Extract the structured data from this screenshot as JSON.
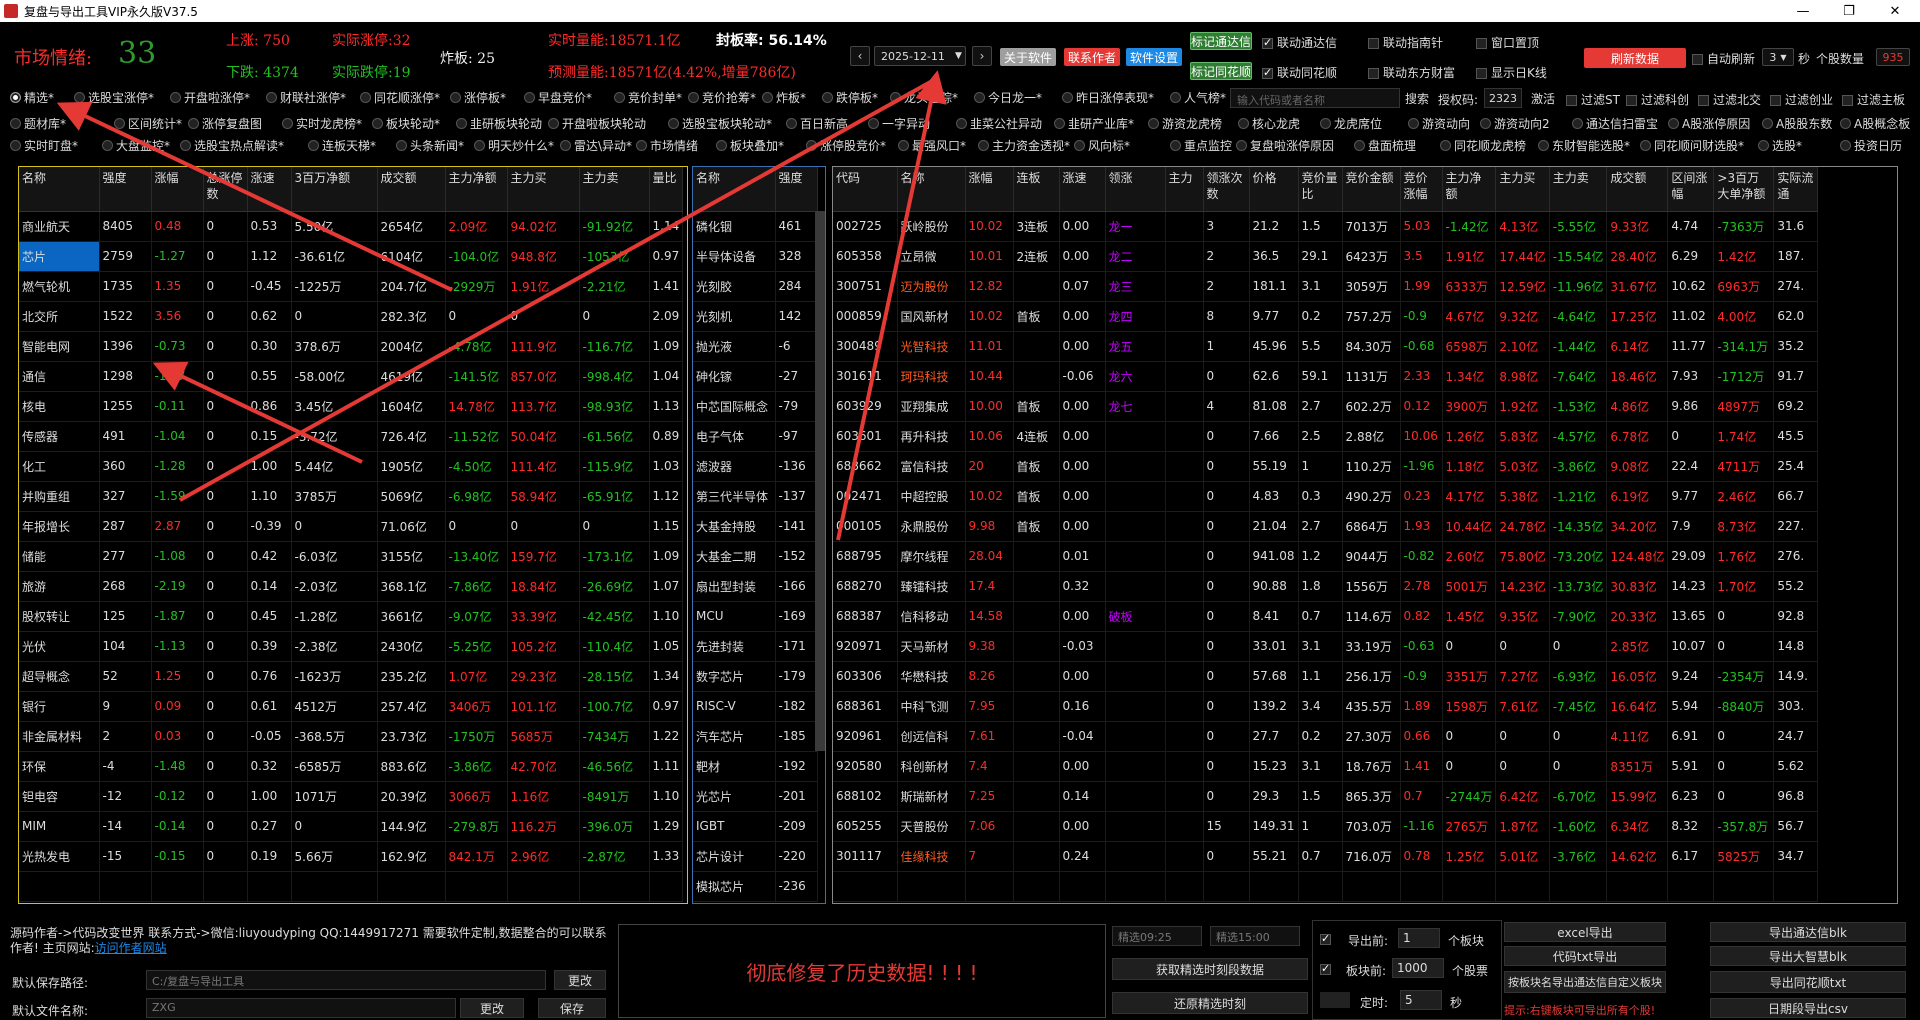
{
  "window": {
    "title": "复盘与导出工具VIP永久版V37.5"
  },
  "header": {
    "sentiment_label": "市场情绪:",
    "sentiment_value": "33",
    "up_label": "上涨:",
    "up_value": "750",
    "limit_up_label": "实际涨停:",
    "limit_up_value": "32",
    "down_label": "下跌:",
    "down_value": "4374",
    "limit_down_label": "实际跌停:",
    "limit_down_value": "19",
    "broken_label": "炸板:",
    "broken_value": "25",
    "realtime_label": "实时量能:",
    "realtime_value": "18571.1亿",
    "seal_rate": "封板率: 56.14%",
    "forecast_label": "预测量能:",
    "forecast_value": "18571亿(4.42%,增量786亿)",
    "date": "2025-12-11",
    "about": "关于软件",
    "contact": "联系作者",
    "settings": "软件设置",
    "mark_tdx": "标记通达信",
    "mark_ths": "标记同花顺",
    "link_tdx": "联动通达信",
    "link_ths": "联动同花顺",
    "link_znz": "联动指南针",
    "link_dfcf": "联动东方财富",
    "window_top": "窗口置顶",
    "show_day_k": "显示日K线",
    "refresh": "刷新数据",
    "auto_refresh": "自动刷新",
    "refresh_seconds": "3",
    "seconds_unit": "秒",
    "stock_count_label": "个股数量",
    "stock_count": "935",
    "colors": {
      "up": "#ff2a2a",
      "down": "#22c022",
      "accent": "#0a66c2"
    }
  },
  "options_row1": [
    "精选*",
    "选股宝涨停*",
    "开盘啦涨停*",
    "财联社涨停*",
    "同花顺涨停*",
    "涨停板*",
    "早盘竞价*",
    "竞价封单*",
    "竞价抢筹*",
    "炸板*",
    "跌停板*",
    "龙头追踪*",
    "今日龙一*",
    "昨日涨停表现*",
    "人气榜*"
  ],
  "search": {
    "placeholder": "输入代码或者名称",
    "button": "搜索",
    "auth_label": "授权码:",
    "auth_value": "2323",
    "activate": "激活",
    "f1": "过滤ST",
    "f2": "过滤科创",
    "f3": "过滤北交",
    "f4": "过滤创业",
    "f5": "过滤主板"
  },
  "options_row2": [
    "题材库*",
    "区间统计*",
    "涨停复盘图",
    "实时龙虎榜*",
    "板块轮动*",
    "韭研板块轮动",
    "开盘啦板块轮动",
    "选股宝板块轮动*",
    "百日新高",
    "一字异动",
    "韭菜公社异动",
    "韭研产业库*",
    "游资龙虎榜",
    "核心龙虎",
    "龙虎席位",
    "游资动向",
    "游资动向2",
    "通达信扫雷宝",
    "A股涨停原因",
    "A股股东数",
    "A股概念板"
  ],
  "options_row3": [
    "实时盯盘*",
    "大盘监控*",
    "选股宝热点解读*",
    "连板天梯*",
    "头条新闻*",
    "明天炒什么*",
    "雷达\\异动*",
    "市场情绪",
    "板块叠加*",
    "涨停股竞价*",
    "最强风口*",
    "主力资金透视*",
    "风向标*",
    "重点监控",
    "复盘啦涨停原因",
    "盘面梳理",
    "同花顺龙虎榜",
    "东财智能选股*",
    "同花顺问财选股*",
    "选股*",
    "投资日历"
  ],
  "sector_table": {
    "headers": [
      "名称",
      "强度",
      "涨幅",
      "总涨停数",
      "涨速",
      "3百万净额",
      "成交额",
      "主力净额",
      "主力买",
      "主力卖",
      "量比"
    ],
    "rows": [
      [
        "商业航天",
        "8405",
        "0.48",
        "0",
        "0.53",
        "5.50亿",
        "2654亿",
        "2.09亿",
        "94.02亿",
        "-91.92亿",
        "1.14"
      ],
      [
        "芯片",
        "2759",
        "-1.27",
        "0",
        "1.12",
        "-36.61亿",
        "6104亿",
        "-104.0亿",
        "948.8亿",
        "-1053亿",
        "0.97"
      ],
      [
        "燃气轮机",
        "1735",
        "1.35",
        "0",
        "-0.45",
        "-1225万",
        "204.7亿",
        "-2929万",
        "1.91亿",
        "-2.21亿",
        "1.41"
      ],
      [
        "北交所",
        "1522",
        "3.56",
        "0",
        "0.62",
        "0",
        "282.3亿",
        "0",
        "0",
        "0",
        "2.09"
      ],
      [
        "智能电网",
        "1396",
        "-0.73",
        "0",
        "0.30",
        "378.6万",
        "2004亿",
        "-4.78亿",
        "111.9亿",
        "-116.7亿",
        "1.09"
      ],
      [
        "通信",
        "1298",
        "-1.47",
        "0",
        "0.55",
        "-58.00亿",
        "4619亿",
        "-141.5亿",
        "857.0亿",
        "-998.4亿",
        "1.04"
      ],
      [
        "核电",
        "1255",
        "-0.11",
        "0",
        "0.86",
        "3.45亿",
        "1604亿",
        "14.78亿",
        "113.7亿",
        "-98.93亿",
        "1.13"
      ],
      [
        "传感器",
        "491",
        "-1.04",
        "0",
        "0.15",
        "-3.72亿",
        "726.4亿",
        "-11.52亿",
        "50.04亿",
        "-61.56亿",
        "0.89"
      ],
      [
        "化工",
        "360",
        "-1.28",
        "0",
        "1.00",
        "5.44亿",
        "1905亿",
        "-4.50亿",
        "111.4亿",
        "-115.9亿",
        "1.03"
      ],
      [
        "并购重组",
        "327",
        "-1.59",
        "0",
        "1.10",
        "3785万",
        "5069亿",
        "-6.98亿",
        "58.94亿",
        "-65.91亿",
        "1.12"
      ],
      [
        "年报增长",
        "287",
        "2.87",
        "0",
        "-0.39",
        "0",
        "71.06亿",
        "0",
        "0",
        "0",
        "1.15"
      ],
      [
        "储能",
        "277",
        "-1.08",
        "0",
        "0.42",
        "-6.03亿",
        "3155亿",
        "-13.40亿",
        "159.7亿",
        "-173.1亿",
        "1.09"
      ],
      [
        "旅游",
        "268",
        "-2.19",
        "0",
        "0.14",
        "-2.03亿",
        "368.1亿",
        "-7.86亿",
        "18.84亿",
        "-26.69亿",
        "1.07"
      ],
      [
        "股权转让",
        "125",
        "-1.87",
        "0",
        "0.45",
        "-1.28亿",
        "3661亿",
        "-9.07亿",
        "33.39亿",
        "-42.45亿",
        "1.10"
      ],
      [
        "光伏",
        "104",
        "-1.13",
        "0",
        "0.39",
        "-2.38亿",
        "2430亿",
        "-5.25亿",
        "105.2亿",
        "-110.4亿",
        "1.05"
      ],
      [
        "超导概念",
        "52",
        "1.25",
        "0",
        "0.76",
        "-1623万",
        "235.2亿",
        "1.07亿",
        "29.23亿",
        "-28.15亿",
        "1.34"
      ],
      [
        "银行",
        "9",
        "0.09",
        "0",
        "0.61",
        "4512万",
        "257.4亿",
        "3406万",
        "101.1亿",
        "-100.7亿",
        "0.97"
      ],
      [
        "非金属材料",
        "2",
        "0.03",
        "0",
        "-0.05",
        "-368.5万",
        "23.73亿",
        "-1750万",
        "5685万",
        "-7434万",
        "1.22"
      ],
      [
        "环保",
        "-4",
        "-1.48",
        "0",
        "0.32",
        "-6585万",
        "883.6亿",
        "-3.86亿",
        "42.70亿",
        "-46.56亿",
        "1.11"
      ],
      [
        "钽电容",
        "-12",
        "-0.12",
        "0",
        "1.00",
        "1071万",
        "20.39亿",
        "3066万",
        "1.16亿",
        "-8491万",
        "1.10"
      ],
      [
        "MIM",
        "-14",
        "-0.14",
        "0",
        "0.27",
        "0",
        "144.9亿",
        "-279.8万",
        "116.2万",
        "-396.0万",
        "1.29"
      ],
      [
        "光热发电",
        "-15",
        "-0.15",
        "0",
        "0.19",
        "5.66万",
        "162.9亿",
        "842.1万",
        "2.96亿",
        "-2.87亿",
        "1.33"
      ],
      [
        "",
        "",
        "",
        "",
        "",
        "",
        "",
        "",
        "",
        "",
        ""
      ]
    ]
  },
  "concept_table": {
    "headers": [
      "名称",
      "强度"
    ],
    "rows": [
      [
        "磷化铟",
        "461"
      ],
      [
        "半导体设备",
        "328"
      ],
      [
        "光刻胶",
        "284"
      ],
      [
        "光刻机",
        "142"
      ],
      [
        "抛光液",
        "-6"
      ],
      [
        "砷化镓",
        "-27"
      ],
      [
        "中芯国际概念",
        "-79"
      ],
      [
        "电子气体",
        "-97"
      ],
      [
        "滤波器",
        "-136"
      ],
      [
        "第三代半导体",
        "-137"
      ],
      [
        "大基金持股",
        "-141"
      ],
      [
        "大基金二期",
        "-152"
      ],
      [
        "扇出型封装",
        "-166"
      ],
      [
        "MCU",
        "-169"
      ],
      [
        "先进封装",
        "-171"
      ],
      [
        "数字芯片",
        "-179"
      ],
      [
        "RISC-V",
        "-182"
      ],
      [
        "汽车芯片",
        "-185"
      ],
      [
        "靶材",
        "-192"
      ],
      [
        "光芯片",
        "-201"
      ],
      [
        "IGBT",
        "-209"
      ],
      [
        "芯片设计",
        "-220"
      ],
      [
        "模拟芯片",
        "-236"
      ]
    ]
  },
  "stock_table": {
    "headers": [
      "代码",
      "名称",
      "涨幅",
      "连板",
      "涨速",
      "领涨",
      "主力",
      "领涨次数",
      "价格",
      "竞价量比",
      "竞价金额",
      "竞价涨幅",
      "主力净额",
      "主力买",
      "主力卖",
      "成交额",
      "区间涨幅",
      ">3百万大单净额",
      "实际流通"
    ],
    "rows": [
      [
        "002725",
        "跃岭股份",
        "10.02",
        "3连板",
        "0.00",
        "龙一",
        "",
        "3",
        "21.2",
        "1.5",
        "7013万",
        "5.03",
        "-1.42亿",
        "4.13亿",
        "-5.55亿",
        "9.33亿",
        "4.74",
        "-7363万",
        "31.6"
      ],
      [
        "605358",
        "立昂微",
        "10.01",
        "2连板",
        "0.00",
        "龙二",
        "",
        "2",
        "36.5",
        "29.1",
        "6423万",
        "3.5",
        "1.91亿",
        "17.44亿",
        "-15.54亿",
        "28.40亿",
        "6.29",
        "1.42亿",
        "187."
      ],
      [
        "300751",
        "迈为股份",
        "12.82",
        "",
        "0.07",
        "龙三",
        "",
        "2",
        "181.1",
        "3.1",
        "3059万",
        "1.99",
        "6333万",
        "12.59亿",
        "-11.96亿",
        "31.67亿",
        "10.62",
        "6963万",
        "274."
      ],
      [
        "000859",
        "国风新材",
        "10.02",
        "首板",
        "0.00",
        "龙四",
        "",
        "8",
        "9.77",
        "0.2",
        "757.2万",
        "-0.9",
        "4.67亿",
        "9.32亿",
        "-4.64亿",
        "17.25亿",
        "11.02",
        "4.00亿",
        "62.0"
      ],
      [
        "300489",
        "光智科技",
        "11.01",
        "",
        "0.00",
        "龙五",
        "",
        "1",
        "45.96",
        "5.5",
        "84.30万",
        "-0.68",
        "6598万",
        "2.10亿",
        "-1.44亿",
        "6.14亿",
        "11.77",
        "-314.1万",
        "35.2"
      ],
      [
        "301611",
        "珂玛科技",
        "10.44",
        "",
        "-0.06",
        "龙六",
        "",
        "0",
        "62.6",
        "59.1",
        "1131万",
        "2.33",
        "1.34亿",
        "8.98亿",
        "-7.64亿",
        "18.46亿",
        "7.93",
        "-1712万",
        "91.7"
      ],
      [
        "603929",
        "亚翔集成",
        "10.00",
        "首板",
        "0.00",
        "龙七",
        "",
        "4",
        "81.08",
        "2.7",
        "602.2万",
        "0.12",
        "3900万",
        "1.92亿",
        "-1.53亿",
        "4.86亿",
        "9.86",
        "4897万",
        "69.2"
      ],
      [
        "603601",
        "再升科技",
        "10.06",
        "4连板",
        "0.00",
        "",
        "",
        "0",
        "7.66",
        "2.5",
        "2.88亿",
        "10.06",
        "1.26亿",
        "5.83亿",
        "-4.57亿",
        "6.78亿",
        "0",
        "1.74亿",
        "45.5"
      ],
      [
        "688662",
        "富信科技",
        "20",
        "首板",
        "0.00",
        "",
        "",
        "0",
        "55.19",
        "1",
        "110.2万",
        "-1.96",
        "1.18亿",
        "5.03亿",
        "-3.86亿",
        "9.08亿",
        "22.4",
        "4711万",
        "25.4"
      ],
      [
        "002471",
        "中超控股",
        "10.02",
        "首板",
        "0.00",
        "",
        "",
        "0",
        "4.83",
        "0.3",
        "490.2万",
        "0.23",
        "4.17亿",
        "5.38亿",
        "-1.21亿",
        "6.19亿",
        "9.77",
        "2.46亿",
        "66.7"
      ],
      [
        "000105",
        "永鼎股份",
        "9.98",
        "首板",
        "0.00",
        "",
        "",
        "0",
        "21.04",
        "2.7",
        "6864万",
        "1.93",
        "10.44亿",
        "24.78亿",
        "-14.35亿",
        "34.20亿",
        "7.9",
        "8.73亿",
        "227."
      ],
      [
        "688795",
        "摩尔线程",
        "28.04",
        "",
        "0.01",
        "",
        "",
        "0",
        "941.08",
        "1.2",
        "9044万",
        "-0.82",
        "2.60亿",
        "75.80亿",
        "-73.20亿",
        "124.48亿",
        "29.09",
        "1.76亿",
        "276."
      ],
      [
        "688270",
        "臻镭科技",
        "17.4",
        "",
        "0.32",
        "",
        "",
        "0",
        "90.88",
        "1.8",
        "1556万",
        "2.78",
        "5001万",
        "14.23亿",
        "-13.73亿",
        "30.83亿",
        "14.23",
        "1.70亿",
        "55.2"
      ],
      [
        "688387",
        "信科移动",
        "14.58",
        "",
        "0.00",
        "破板",
        "",
        "0",
        "8.41",
        "0.7",
        "114.6万",
        "0.82",
        "1.45亿",
        "9.35亿",
        "-7.90亿",
        "20.33亿",
        "13.65",
        "0",
        "92.8"
      ],
      [
        "920971",
        "天马新材",
        "9.38",
        "",
        "-0.03",
        "",
        "",
        "0",
        "33.01",
        "3.1",
        "33.19万",
        "-0.63",
        "0",
        "0",
        "0",
        "2.85亿",
        "10.07",
        "0",
        "14.8"
      ],
      [
        "603306",
        "华懋科技",
        "8.26",
        "",
        "0.00",
        "",
        "",
        "0",
        "57.68",
        "1.1",
        "256.1万",
        "-0.9",
        "3351万",
        "7.27亿",
        "-6.93亿",
        "16.05亿",
        "9.24",
        "-2354万",
        "14.9."
      ],
      [
        "688361",
        "中科飞测",
        "7.95",
        "",
        "0.16",
        "",
        "",
        "0",
        "139.2",
        "3.4",
        "435.5万",
        "1.89",
        "1598万",
        "7.61亿",
        "-7.45亿",
        "16.64亿",
        "5.94",
        "-8840万",
        "303."
      ],
      [
        "920961",
        "创远信科",
        "7.61",
        "",
        "-0.04",
        "",
        "",
        "0",
        "27.7",
        "0.2",
        "27.30万",
        "0.66",
        "0",
        "0",
        "0",
        "4.11亿",
        "6.91",
        "0",
        "24.7"
      ],
      [
        "920580",
        "科创新材",
        "7.4",
        "",
        "0.00",
        "",
        "",
        "0",
        "15.23",
        "3.1",
        "18.76万",
        "1.41",
        "0",
        "0",
        "0",
        "8351万",
        "5.91",
        "0",
        "5.62"
      ],
      [
        "688102",
        "斯瑞新材",
        "7.25",
        "",
        "0.14",
        "",
        "",
        "0",
        "29.3",
        "1.5",
        "865.3万",
        "0.7",
        "-2744万",
        "6.42亿",
        "-6.70亿",
        "15.99亿",
        "6.23",
        "0",
        "96.8"
      ],
      [
        "605255",
        "天普股份",
        "7.06",
        "",
        "0.00",
        "",
        "",
        "15",
        "149.31",
        "1",
        "703.0万",
        "-1.16",
        "2765万",
        "1.87亿",
        "-1.60亿",
        "6.34亿",
        "8.32",
        "-357.8万",
        "56.7"
      ],
      [
        "301117",
        "佳缘科技",
        "7",
        "",
        "0.24",
        "",
        "",
        "0",
        "55.21",
        "0.7",
        "716.0万",
        "0.78",
        "1.25亿",
        "5.01亿",
        "-3.76亿",
        "14.62亿",
        "6.17",
        "5825万",
        "34.7"
      ],
      [
        "",
        "",
        "",
        "",
        "",
        "",
        "",
        "",
        "",
        "",
        "",
        "",
        "",
        "",
        "",
        "",
        "",
        "",
        ""
      ]
    ]
  },
  "bottom": {
    "author_text": "源码作者->代码改变世界 联系方式->微信:liuyoudyping QQ:1449917271 需要软件定制,数据整合的可以联系作者! 主页网站:",
    "author_link": "访问作者网站",
    "save_path_label": "默认保存路径:",
    "save_path": "C:/复盘与导出工具",
    "change1": "更改",
    "file_name_label": "默认文件名称:",
    "file_name": "ZXG",
    "change2": "更改",
    "save": "保存",
    "notice": "彻底修复了历史数据! ! ! !",
    "pick0925": "精选09:25",
    "pick1500": "精选15:00",
    "get_pick": "获取精选时刻段数据",
    "restore_pick": "还原精选时刻",
    "export_front_label": "导出前:",
    "export_front_val": "1",
    "sector_unit": "个板块",
    "sector_front_label": "板块前:",
    "sector_front_val": "1000",
    "stock_unit": "个股票",
    "timer_label": "定时:",
    "timer_val": "5",
    "timer_unit": "秒",
    "excel": "excel导出",
    "code_txt": "代码txt导出",
    "export_by_sector": "按板块名导出通达信自定义板块",
    "tip": "提示:右键板块可导出所有个股!",
    "exp_tdx": "导出通达信blk",
    "exp_dzh": "导出大智慧blk",
    "exp_ths": "导出同花顺txt",
    "exp_daily": "日期段导出csv"
  }
}
